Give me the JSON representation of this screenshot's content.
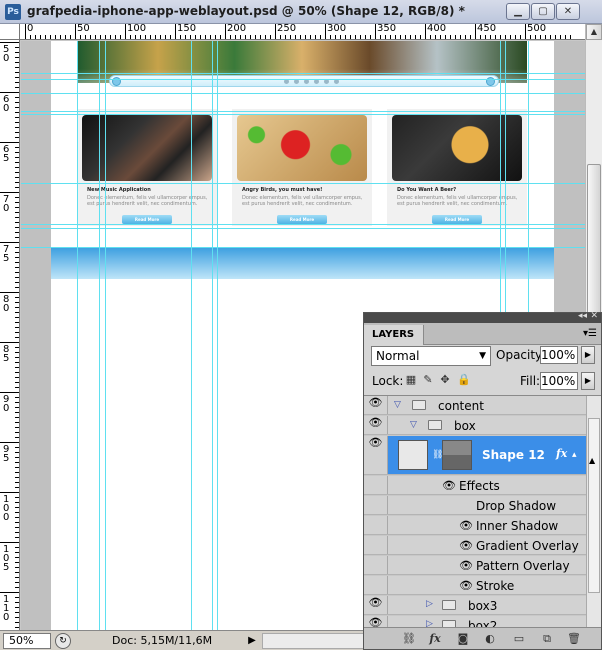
{
  "window": {
    "title": "grafpedia-iphone-app-weblayout.psd @ 50% (Shape 12, RGB/8) *",
    "app_icon": "Ps"
  },
  "ruler_top": [
    "0",
    "50",
    "100",
    "150",
    "200",
    "250",
    "300",
    "350",
    "400",
    "450",
    "500"
  ],
  "ruler_left": [
    "5 0",
    "6 0",
    "6 5",
    "7 0",
    "7 5",
    "8 0",
    "8 5",
    "9 0",
    "9 5",
    "1 0 0",
    "1 0 5",
    "1 1 0"
  ],
  "canvas": {
    "cards": [
      {
        "title": "New Music Application",
        "body": "Donec elementum, felis vel ullamcorper empus, est purus hendrerit velit, nec condimentum.",
        "button": "Read More"
      },
      {
        "title": "Angry Birds, you must have!",
        "body": "Donec elementum, felis vel ullamcorper empus, est purus hendrerit velit, nec condimentum.",
        "button": "Read More"
      },
      {
        "title": "Do You Want A Beer?",
        "body": "Donec elementum, felis vel ullamcorper empus, est purus hendrerit velit, nec condimentum.",
        "button": "Read More"
      }
    ]
  },
  "status": {
    "zoom": "50%",
    "doc_info": "Doc: 5,15M/11,6M"
  },
  "layers_panel": {
    "tab": "LAYERS",
    "blend_mode": "Normal",
    "opacity_label": "Opacity:",
    "opacity_value": "100%",
    "lock_label": "Lock:",
    "fill_label": "Fill:",
    "fill_value": "100%",
    "rows": {
      "content": "content",
      "box": "box",
      "shape12": "Shape 12",
      "effects": "Effects",
      "drop_shadow": "Drop Shadow",
      "inner_shadow": "Inner Shadow",
      "gradient_overlay": "Gradient Overlay",
      "pattern_overlay": "Pattern Overlay",
      "stroke": "Stroke",
      "box3": "box3",
      "box2": "box2"
    },
    "fx_label": "fx"
  },
  "colors": {
    "selection": "#3b8ee8",
    "guide": "#5fe0f0",
    "band": "#3a9ee0"
  }
}
